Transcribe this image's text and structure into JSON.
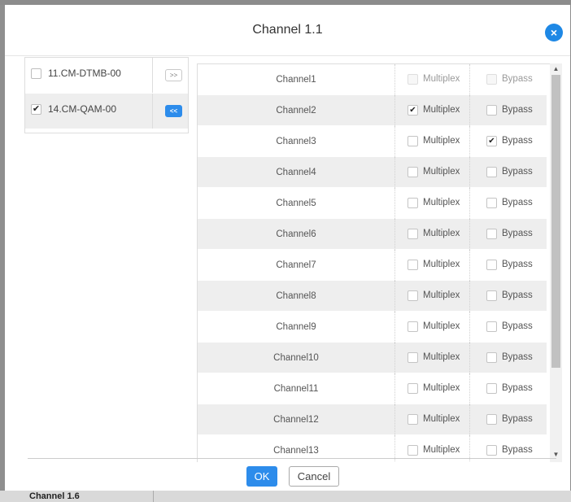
{
  "dialog": {
    "title": "Channel 1.1",
    "close_glyph": "×",
    "ok_label": "OK",
    "cancel_label": "Cancel"
  },
  "background": {
    "label": "Channel 1.6"
  },
  "left_list": [
    {
      "label": "11.CM-DTMB-00",
      "checked": false,
      "button": ">>",
      "active": false
    },
    {
      "label": "14.CM-QAM-00",
      "checked": true,
      "button": "<<",
      "active": true
    }
  ],
  "channels": [
    {
      "name": "Channel1",
      "multiplex_label": "Multiplex",
      "bypass_label": "Bypass",
      "multiplex": false,
      "bypass": false,
      "disabled": true
    },
    {
      "name": "Channel2",
      "multiplex_label": "Multiplex",
      "bypass_label": "Bypass",
      "multiplex": true,
      "bypass": false,
      "disabled": false
    },
    {
      "name": "Channel3",
      "multiplex_label": "Multiplex",
      "bypass_label": "Bypass",
      "multiplex": false,
      "bypass": true,
      "disabled": false
    },
    {
      "name": "Channel4",
      "multiplex_label": "Multiplex",
      "bypass_label": "Bypass",
      "multiplex": false,
      "bypass": false,
      "disabled": false
    },
    {
      "name": "Channel5",
      "multiplex_label": "Multiplex",
      "bypass_label": "Bypass",
      "multiplex": false,
      "bypass": false,
      "disabled": false
    },
    {
      "name": "Channel6",
      "multiplex_label": "Multiplex",
      "bypass_label": "Bypass",
      "multiplex": false,
      "bypass": false,
      "disabled": false
    },
    {
      "name": "Channel7",
      "multiplex_label": "Multiplex",
      "bypass_label": "Bypass",
      "multiplex": false,
      "bypass": false,
      "disabled": false
    },
    {
      "name": "Channel8",
      "multiplex_label": "Multiplex",
      "bypass_label": "Bypass",
      "multiplex": false,
      "bypass": false,
      "disabled": false
    },
    {
      "name": "Channel9",
      "multiplex_label": "Multiplex",
      "bypass_label": "Bypass",
      "multiplex": false,
      "bypass": false,
      "disabled": false
    },
    {
      "name": "Channel10",
      "multiplex_label": "Multiplex",
      "bypass_label": "Bypass",
      "multiplex": false,
      "bypass": false,
      "disabled": false
    },
    {
      "name": "Channel11",
      "multiplex_label": "Multiplex",
      "bypass_label": "Bypass",
      "multiplex": false,
      "bypass": false,
      "disabled": false
    },
    {
      "name": "Channel12",
      "multiplex_label": "Multiplex",
      "bypass_label": "Bypass",
      "multiplex": false,
      "bypass": false,
      "disabled": false
    },
    {
      "name": "Channel13",
      "multiplex_label": "Multiplex",
      "bypass_label": "Bypass",
      "multiplex": false,
      "bypass": false,
      "disabled": false
    }
  ],
  "colors": {
    "accent": "#2d8ceb",
    "close_button": "#1e88e5",
    "row_alt": "#eeeeee"
  },
  "icons": {
    "close": "close-icon",
    "scroll_up": "arrow-up-icon",
    "scroll_down": "arrow-down-icon"
  }
}
